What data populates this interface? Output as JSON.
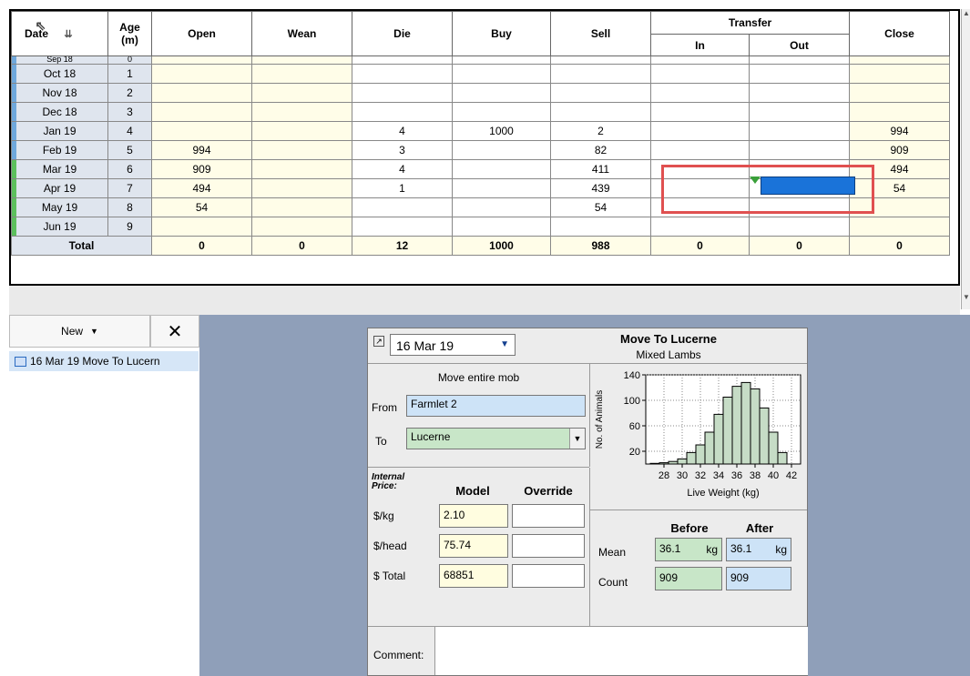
{
  "grid": {
    "headers": {
      "date": "Date",
      "age": "Age",
      "age_unit": "(m)",
      "open": "Open",
      "wean": "Wean",
      "die": "Die",
      "buy": "Buy",
      "sell": "Sell",
      "transfer": "Transfer",
      "transfer_in": "In",
      "transfer_out": "Out",
      "close": "Close"
    },
    "partial_row": {
      "date": "Sep 18",
      "age": "0"
    },
    "rows": [
      {
        "date": "Oct 18",
        "age": "1",
        "open": "",
        "wean": "",
        "die": "",
        "buy": "",
        "sell": "",
        "in": "",
        "out": "",
        "close": "",
        "marker": "#6fa8dc"
      },
      {
        "date": "Nov 18",
        "age": "2",
        "open": "",
        "wean": "",
        "die": "",
        "buy": "",
        "sell": "",
        "in": "",
        "out": "",
        "close": "",
        "marker": "#6fa8dc"
      },
      {
        "date": "Dec 18",
        "age": "3",
        "open": "",
        "wean": "",
        "die": "",
        "buy": "",
        "sell": "",
        "in": "",
        "out": "",
        "close": "",
        "marker": "#6fa8dc"
      },
      {
        "date": "Jan 19",
        "age": "4",
        "open": "",
        "wean": "",
        "die": "4",
        "buy": "1000",
        "sell": "2",
        "in": "",
        "out": "",
        "close": "994",
        "marker": "#6fa8dc"
      },
      {
        "date": "Feb 19",
        "age": "5",
        "open": "994",
        "wean": "",
        "die": "3",
        "buy": "",
        "sell": "82",
        "in": "",
        "out": "",
        "close": "909",
        "marker": "#6fa8dc"
      },
      {
        "date": "Mar 19",
        "age": "6",
        "open": "909",
        "wean": "",
        "die": "4",
        "buy": "",
        "sell": "411",
        "in": "",
        "out": "",
        "close": "494",
        "marker": "#5cc05c"
      },
      {
        "date": "Apr 19",
        "age": "7",
        "open": "494",
        "wean": "",
        "die": "1",
        "buy": "",
        "sell": "439",
        "in": "",
        "out": "",
        "close": "54",
        "marker": "#5cc05c"
      },
      {
        "date": "May 19",
        "age": "8",
        "open": "54",
        "wean": "",
        "die": "",
        "buy": "",
        "sell": "54",
        "in": "",
        "out": "",
        "close": "",
        "marker": "#5cc05c"
      },
      {
        "date": "Jun 19",
        "age": "9",
        "open": "",
        "wean": "",
        "die": "",
        "buy": "",
        "sell": "",
        "in": "",
        "out": "",
        "close": "",
        "marker": "#5cc05c"
      }
    ],
    "totals": {
      "label": "Total",
      "open": "0",
      "wean": "0",
      "die": "12",
      "buy": "1000",
      "sell": "988",
      "in": "0",
      "out": "0",
      "close": "0"
    }
  },
  "left_panel": {
    "new_label": "New",
    "close_icon": "close-icon",
    "event_item": "16 Mar 19 Move To Lucern"
  },
  "form": {
    "date": "16 Mar 19",
    "title": "Move To Lucerne",
    "subtitle": "Mixed Lambs",
    "move_entire_mob": "Move entire mob",
    "from_label": "From",
    "from_value": "Farmlet 2",
    "to_label": "To",
    "to_value": "Lucerne",
    "internal_price_label": "Internal Price:",
    "model_header": "Model",
    "override_header": "Override",
    "price_rows": [
      {
        "label": "$/kg",
        "model": "2.10",
        "override": ""
      },
      {
        "label": "$/head",
        "model": "75.74",
        "override": ""
      },
      {
        "label": "$ Total",
        "model": "68851",
        "override": ""
      }
    ],
    "before_header": "Before",
    "after_header": "After",
    "mean_label": "Mean",
    "mean_before": "36.1",
    "mean_after": "36.1",
    "unit_kg": "kg",
    "count_label": "Count",
    "count_before": "909",
    "count_after": "909",
    "comment_label": "Comment:",
    "comment_value": ""
  },
  "chart_data": {
    "type": "bar",
    "xlabel": "Live Weight (kg)",
    "ylabel": "No. of Animals",
    "x_ticks": [
      "28",
      "30",
      "32",
      "34",
      "36",
      "38",
      "40",
      "42"
    ],
    "y_ticks": [
      "20",
      "60",
      "100",
      "140"
    ],
    "ylim": [
      0,
      140
    ],
    "xlim": [
      26,
      43
    ],
    "bins": [
      {
        "x": 27,
        "y": 1
      },
      {
        "x": 28,
        "y": 2
      },
      {
        "x": 29,
        "y": 4
      },
      {
        "x": 30,
        "y": 8
      },
      {
        "x": 31,
        "y": 18
      },
      {
        "x": 32,
        "y": 30
      },
      {
        "x": 33,
        "y": 50
      },
      {
        "x": 34,
        "y": 78
      },
      {
        "x": 35,
        "y": 105
      },
      {
        "x": 36,
        "y": 122
      },
      {
        "x": 37,
        "y": 128
      },
      {
        "x": 38,
        "y": 118
      },
      {
        "x": 39,
        "y": 88
      },
      {
        "x": 40,
        "y": 50
      },
      {
        "x": 41,
        "y": 18
      }
    ],
    "fill": "#c6dcc6",
    "grid": true
  },
  "colors": {
    "highlight_box": "#e05050",
    "transfer_bar": "#1a73d9",
    "navy_bg": "#8f9fb9",
    "yellow_cell": "#fffde8",
    "green_field": "#c8e6c8",
    "blue_field": "#cde3f7"
  }
}
